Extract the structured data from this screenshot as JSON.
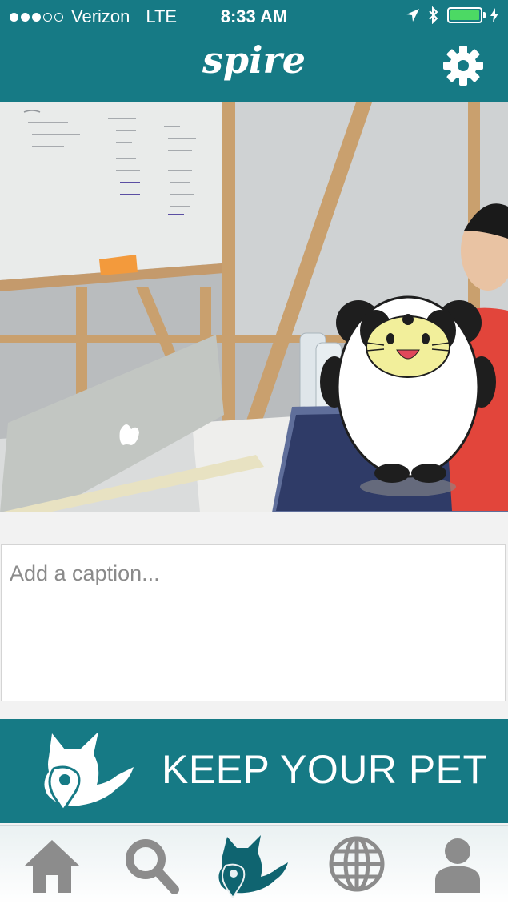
{
  "status_bar": {
    "carrier": "Verizon",
    "network": "LTE",
    "time": "8:33 AM",
    "signal_bars": 3,
    "signal_total": 5,
    "battery_level": 1.0
  },
  "nav": {
    "logo": "spire",
    "settings_icon": "gear-icon"
  },
  "photo": {
    "description_icon": "panda-cat-sticker"
  },
  "caption": {
    "placeholder": "Add a caption..."
  },
  "keep_button": {
    "label": "KEEP YOUR PET",
    "icon": "cat-pin-icon"
  },
  "tab_bar": {
    "tabs": [
      {
        "icon": "home-icon"
      },
      {
        "icon": "search-icon"
      },
      {
        "icon": "cat-pin-icon",
        "active": true
      },
      {
        "icon": "globe-icon"
      },
      {
        "icon": "profile-icon"
      }
    ]
  },
  "colors": {
    "brand": "#167a85",
    "active_tab": "#0f6470",
    "inactive_tab": "#8c8c8c"
  }
}
